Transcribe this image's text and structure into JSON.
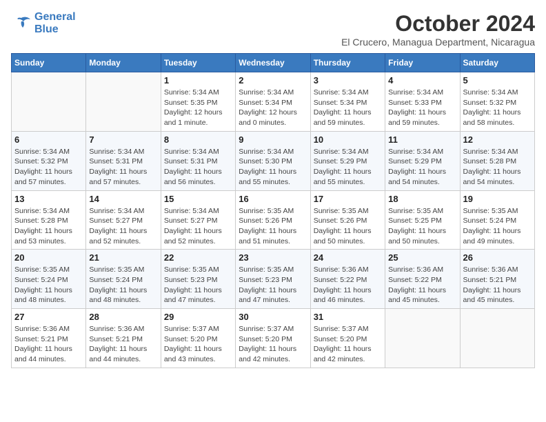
{
  "header": {
    "logo_line1": "General",
    "logo_line2": "Blue",
    "month": "October 2024",
    "location": "El Crucero, Managua Department, Nicaragua"
  },
  "days_of_week": [
    "Sunday",
    "Monday",
    "Tuesday",
    "Wednesday",
    "Thursday",
    "Friday",
    "Saturday"
  ],
  "weeks": [
    [
      {
        "day": "",
        "info": ""
      },
      {
        "day": "",
        "info": ""
      },
      {
        "day": "1",
        "info": "Sunrise: 5:34 AM\nSunset: 5:35 PM\nDaylight: 12 hours and 1 minute."
      },
      {
        "day": "2",
        "info": "Sunrise: 5:34 AM\nSunset: 5:34 PM\nDaylight: 12 hours and 0 minutes."
      },
      {
        "day": "3",
        "info": "Sunrise: 5:34 AM\nSunset: 5:34 PM\nDaylight: 11 hours and 59 minutes."
      },
      {
        "day": "4",
        "info": "Sunrise: 5:34 AM\nSunset: 5:33 PM\nDaylight: 11 hours and 59 minutes."
      },
      {
        "day": "5",
        "info": "Sunrise: 5:34 AM\nSunset: 5:32 PM\nDaylight: 11 hours and 58 minutes."
      }
    ],
    [
      {
        "day": "6",
        "info": "Sunrise: 5:34 AM\nSunset: 5:32 PM\nDaylight: 11 hours and 57 minutes."
      },
      {
        "day": "7",
        "info": "Sunrise: 5:34 AM\nSunset: 5:31 PM\nDaylight: 11 hours and 57 minutes."
      },
      {
        "day": "8",
        "info": "Sunrise: 5:34 AM\nSunset: 5:31 PM\nDaylight: 11 hours and 56 minutes."
      },
      {
        "day": "9",
        "info": "Sunrise: 5:34 AM\nSunset: 5:30 PM\nDaylight: 11 hours and 55 minutes."
      },
      {
        "day": "10",
        "info": "Sunrise: 5:34 AM\nSunset: 5:29 PM\nDaylight: 11 hours and 55 minutes."
      },
      {
        "day": "11",
        "info": "Sunrise: 5:34 AM\nSunset: 5:29 PM\nDaylight: 11 hours and 54 minutes."
      },
      {
        "day": "12",
        "info": "Sunrise: 5:34 AM\nSunset: 5:28 PM\nDaylight: 11 hours and 54 minutes."
      }
    ],
    [
      {
        "day": "13",
        "info": "Sunrise: 5:34 AM\nSunset: 5:28 PM\nDaylight: 11 hours and 53 minutes."
      },
      {
        "day": "14",
        "info": "Sunrise: 5:34 AM\nSunset: 5:27 PM\nDaylight: 11 hours and 52 minutes."
      },
      {
        "day": "15",
        "info": "Sunrise: 5:34 AM\nSunset: 5:27 PM\nDaylight: 11 hours and 52 minutes."
      },
      {
        "day": "16",
        "info": "Sunrise: 5:35 AM\nSunset: 5:26 PM\nDaylight: 11 hours and 51 minutes."
      },
      {
        "day": "17",
        "info": "Sunrise: 5:35 AM\nSunset: 5:26 PM\nDaylight: 11 hours and 50 minutes."
      },
      {
        "day": "18",
        "info": "Sunrise: 5:35 AM\nSunset: 5:25 PM\nDaylight: 11 hours and 50 minutes."
      },
      {
        "day": "19",
        "info": "Sunrise: 5:35 AM\nSunset: 5:24 PM\nDaylight: 11 hours and 49 minutes."
      }
    ],
    [
      {
        "day": "20",
        "info": "Sunrise: 5:35 AM\nSunset: 5:24 PM\nDaylight: 11 hours and 48 minutes."
      },
      {
        "day": "21",
        "info": "Sunrise: 5:35 AM\nSunset: 5:24 PM\nDaylight: 11 hours and 48 minutes."
      },
      {
        "day": "22",
        "info": "Sunrise: 5:35 AM\nSunset: 5:23 PM\nDaylight: 11 hours and 47 minutes."
      },
      {
        "day": "23",
        "info": "Sunrise: 5:35 AM\nSunset: 5:23 PM\nDaylight: 11 hours and 47 minutes."
      },
      {
        "day": "24",
        "info": "Sunrise: 5:36 AM\nSunset: 5:22 PM\nDaylight: 11 hours and 46 minutes."
      },
      {
        "day": "25",
        "info": "Sunrise: 5:36 AM\nSunset: 5:22 PM\nDaylight: 11 hours and 45 minutes."
      },
      {
        "day": "26",
        "info": "Sunrise: 5:36 AM\nSunset: 5:21 PM\nDaylight: 11 hours and 45 minutes."
      }
    ],
    [
      {
        "day": "27",
        "info": "Sunrise: 5:36 AM\nSunset: 5:21 PM\nDaylight: 11 hours and 44 minutes."
      },
      {
        "day": "28",
        "info": "Sunrise: 5:36 AM\nSunset: 5:21 PM\nDaylight: 11 hours and 44 minutes."
      },
      {
        "day": "29",
        "info": "Sunrise: 5:37 AM\nSunset: 5:20 PM\nDaylight: 11 hours and 43 minutes."
      },
      {
        "day": "30",
        "info": "Sunrise: 5:37 AM\nSunset: 5:20 PM\nDaylight: 11 hours and 42 minutes."
      },
      {
        "day": "31",
        "info": "Sunrise: 5:37 AM\nSunset: 5:20 PM\nDaylight: 11 hours and 42 minutes."
      },
      {
        "day": "",
        "info": ""
      },
      {
        "day": "",
        "info": ""
      }
    ]
  ]
}
